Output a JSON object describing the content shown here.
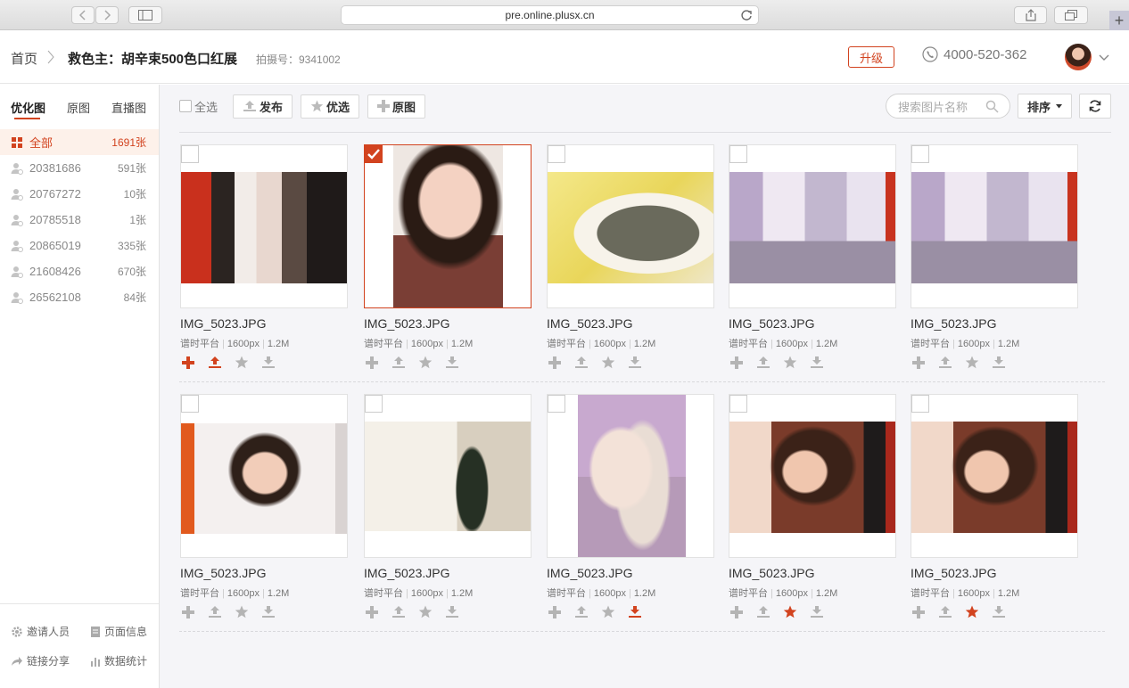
{
  "browser": {
    "url": "pre.online.plusx.cn"
  },
  "header": {
    "home": "首页",
    "title": "救色主：胡辛束500色口红展",
    "shoot_no": "拍摄号：9341002",
    "upgrade_label": "升级",
    "phone": "4000-520-362"
  },
  "sidebar": {
    "tabs": [
      "优化图",
      "原图",
      "直播图"
    ],
    "groups": [
      {
        "name": "全部",
        "count": "1691张"
      },
      {
        "name": "20381686",
        "count": "591张"
      },
      {
        "name": "20767272",
        "count": "10张"
      },
      {
        "name": "20785518",
        "count": "1张"
      },
      {
        "name": "20865019",
        "count": "335张"
      },
      {
        "name": "21608426",
        "count": "670张"
      },
      {
        "name": "26562108",
        "count": "84张"
      }
    ],
    "footer": {
      "invite": "邀请人员",
      "page_info": "页面信息",
      "share": "链接分享",
      "stats": "数据统计"
    }
  },
  "toolbar": {
    "select_all": "全选",
    "publish": "发布",
    "preferred": "优选",
    "original": "原图",
    "search_placeholder": "搜索图片名称",
    "sort": "排序"
  },
  "photos": [
    {
      "name": "IMG_5023.JPG",
      "source": "谱时平台",
      "size": "1600px",
      "filesize": "1.2M"
    },
    {
      "name": "IMG_5023.JPG",
      "source": "谱时平台",
      "size": "1600px",
      "filesize": "1.2M"
    },
    {
      "name": "IMG_5023.JPG",
      "source": "谱时平台",
      "size": "1600px",
      "filesize": "1.2M"
    },
    {
      "name": "IMG_5023.JPG",
      "source": "谱时平台",
      "size": "1600px",
      "filesize": "1.2M"
    },
    {
      "name": "IMG_5023.JPG",
      "source": "谱时平台",
      "size": "1600px",
      "filesize": "1.2M"
    },
    {
      "name": "IMG_5023.JPG",
      "source": "谱时平台",
      "size": "1600px",
      "filesize": "1.2M"
    },
    {
      "name": "IMG_5023.JPG",
      "source": "谱时平台",
      "size": "1600px",
      "filesize": "1.2M"
    },
    {
      "name": "IMG_5023.JPG",
      "source": "谱时平台",
      "size": "1600px",
      "filesize": "1.2M"
    },
    {
      "name": "IMG_5023.JPG",
      "source": "谱时平台",
      "size": "1600px",
      "filesize": "1.2M"
    },
    {
      "name": "IMG_5023.JPG",
      "source": "谱时平台",
      "size": "1600px",
      "filesize": "1.2M"
    }
  ],
  "colors": {
    "accent": "#d2431f",
    "icon_gray": "#b4b4b4"
  }
}
